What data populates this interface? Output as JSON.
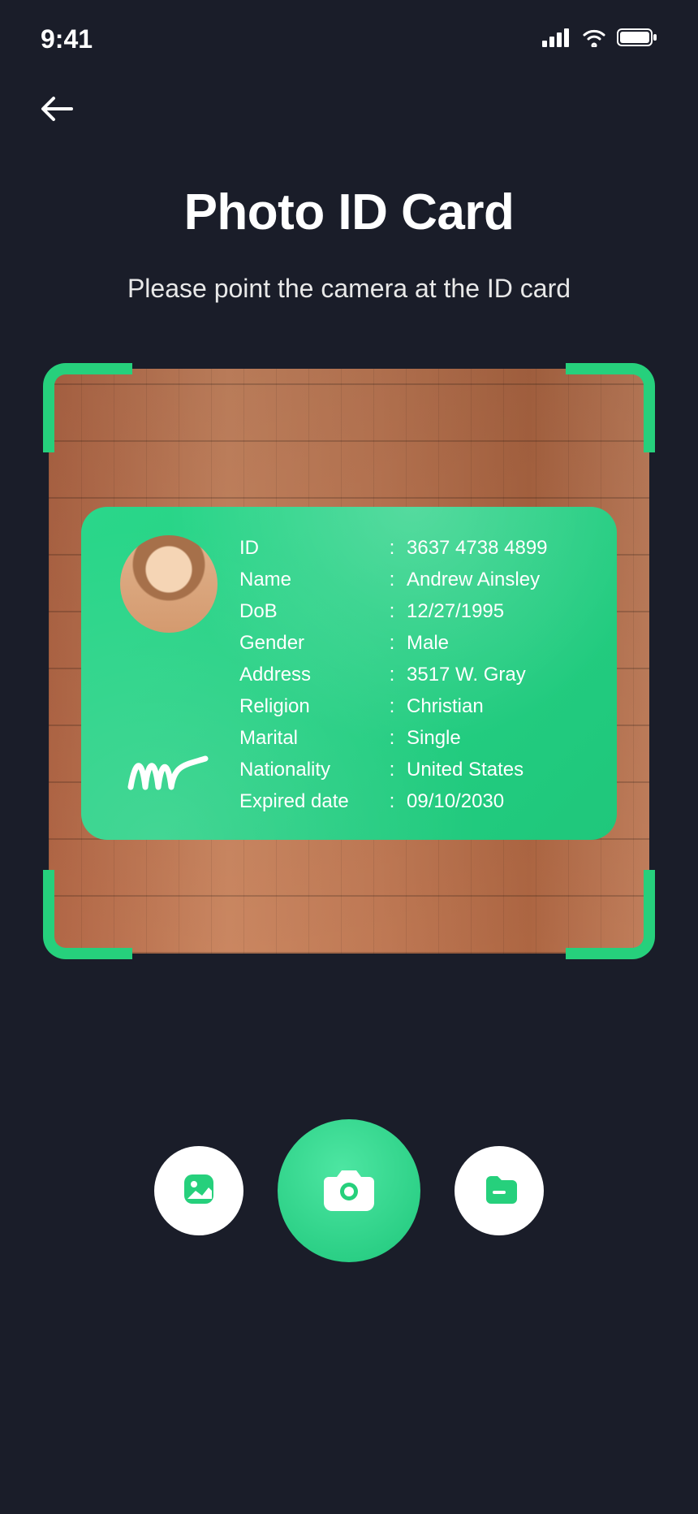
{
  "status": {
    "time": "9:41"
  },
  "page": {
    "title": "Photo ID Card",
    "subtitle": "Please point the camera at the ID card"
  },
  "id_card": {
    "labels": {
      "id": "ID",
      "name": "Name",
      "dob": "DoB",
      "gender": "Gender",
      "address": "Address",
      "religion": "Religion",
      "marital": "Marital",
      "nationality": "Nationality",
      "expired": "Expired date"
    },
    "values": {
      "id": "3637 4738 4899",
      "name": "Andrew Ainsley",
      "dob": "12/27/1995",
      "gender": "Male",
      "address": "3517 W. Gray",
      "religion": "Christian",
      "marital": "Single",
      "nationality": "United States",
      "expired": "09/10/2030"
    }
  },
  "colors": {
    "accent": "#26d07c"
  }
}
